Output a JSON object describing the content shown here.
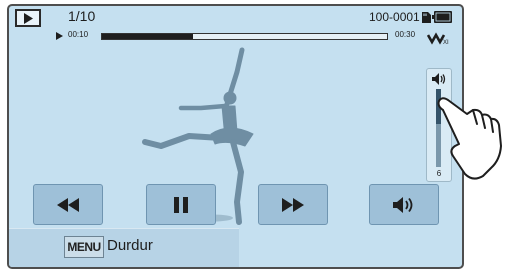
{
  "header": {
    "counter": "1/10",
    "file_number": "100-0001"
  },
  "progress": {
    "elapsed": "00:10",
    "total": "00:30",
    "fraction": 0.32
  },
  "volume": {
    "level": 6,
    "fraction": 0.55
  },
  "controls": {
    "rewind": "rewind-icon",
    "pause": "pause-icon",
    "fast_forward": "fast-forward-icon",
    "volume": "speaker-icon"
  },
  "footer": {
    "menu_key": "MENU",
    "menu_action": "Durdur"
  }
}
